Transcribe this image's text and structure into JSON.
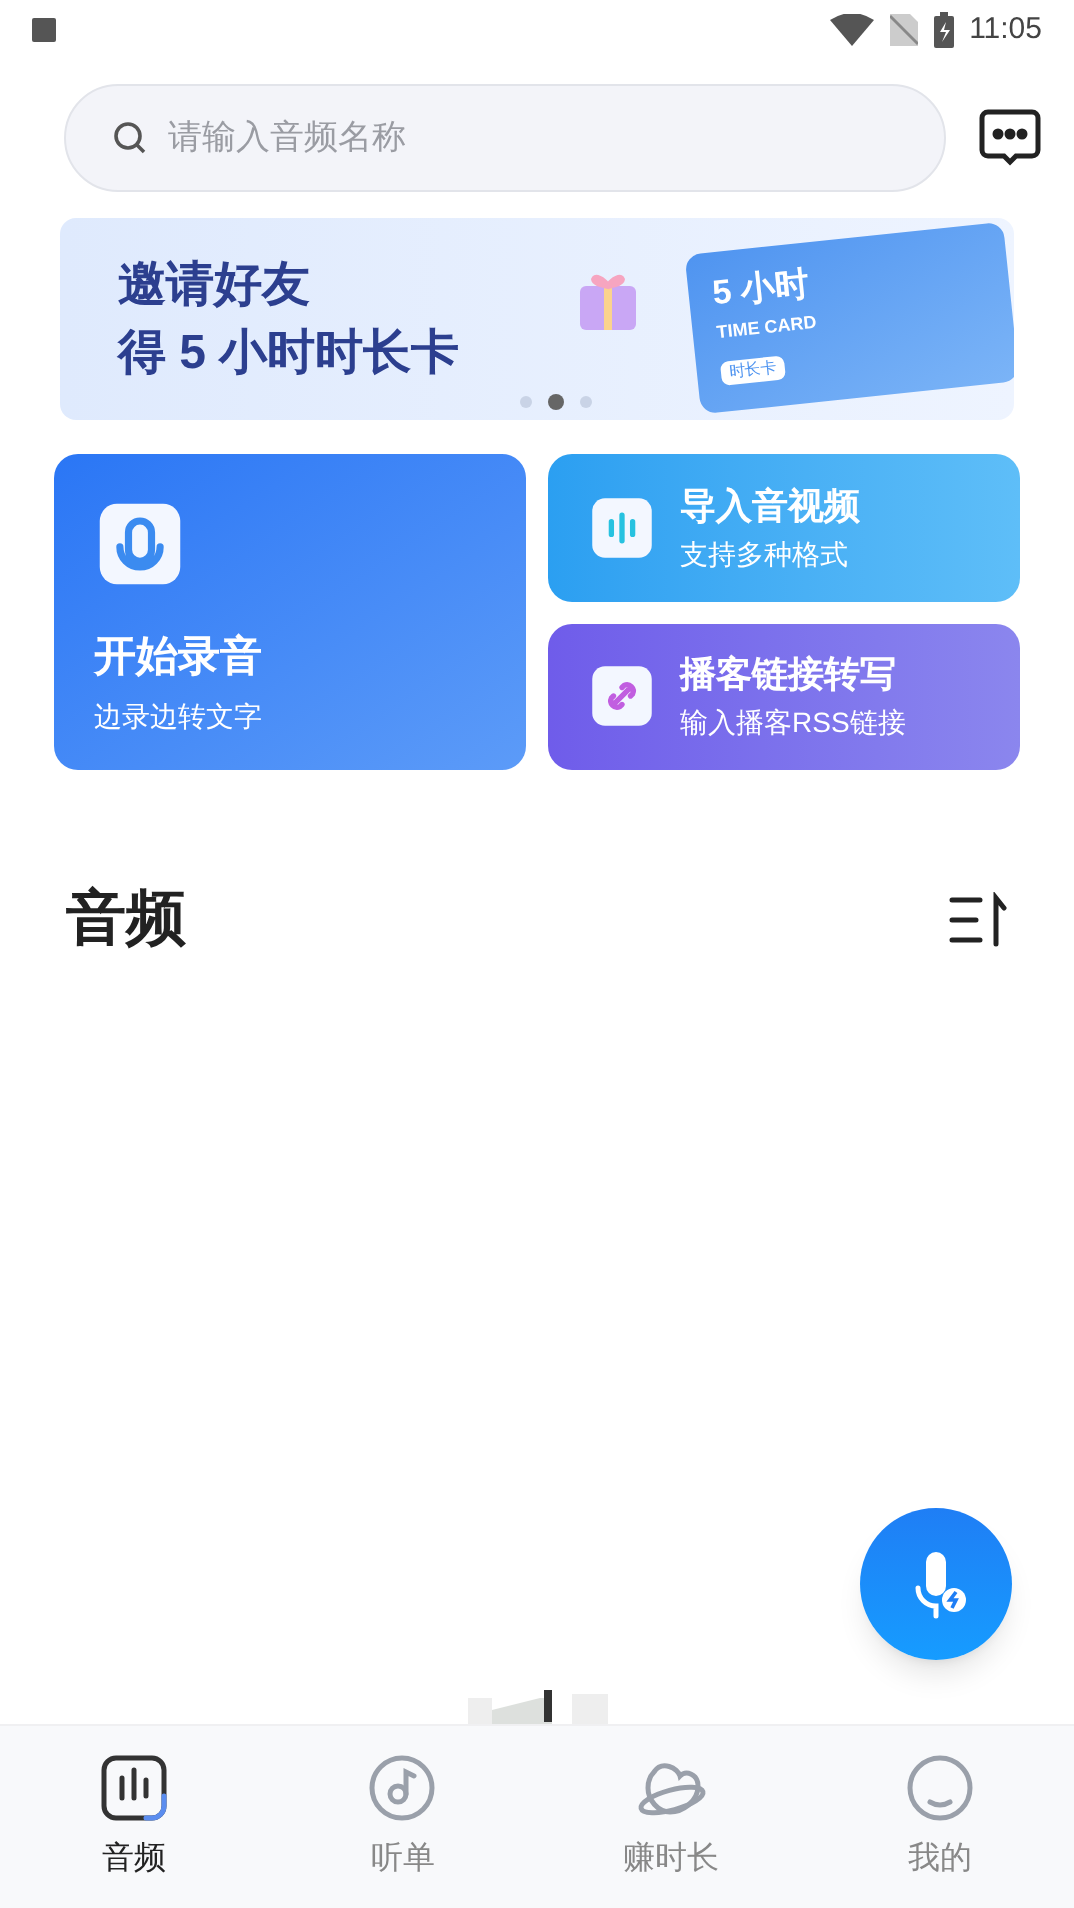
{
  "status_bar": {
    "time": "11:05"
  },
  "search": {
    "placeholder": "请输入音频名称"
  },
  "banner": {
    "title": "邀请好友",
    "subtitle": "得 5 小时时长卡",
    "card_title": "5 小时",
    "card_subtitle": "TIME CARD",
    "card_tag": "时长卡",
    "dots": [
      {
        "selected": false
      },
      {
        "selected": true
      },
      {
        "selected": false
      }
    ]
  },
  "actions": [
    {
      "kind": "record",
      "title": "开始录音",
      "subtitle": "边录边转文字"
    },
    {
      "kind": "import",
      "title": "导入音视频",
      "subtitle": "支持多种格式"
    },
    {
      "kind": "podcast",
      "title": "播客链接转写",
      "subtitle": "输入播客RSS链接"
    }
  ],
  "section": {
    "title": "音频"
  },
  "bottom_nav": [
    {
      "kind": "audio",
      "label": "音频",
      "selected": true
    },
    {
      "kind": "list",
      "label": "听单",
      "selected": false
    },
    {
      "kind": "earn",
      "label": "赚时长",
      "selected": false
    },
    {
      "kind": "me",
      "label": "我的",
      "selected": false
    }
  ]
}
